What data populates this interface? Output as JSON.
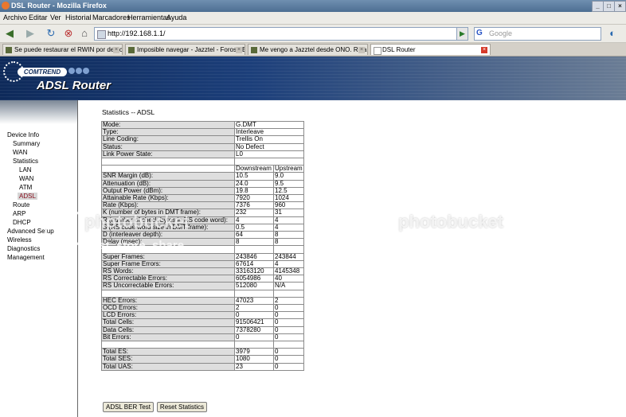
{
  "window": {
    "title": "DSL Router - Mozilla Firefox"
  },
  "menu": [
    "Archivo",
    "Editar",
    "Ver",
    "Historial",
    "Marcadores",
    "Herramientas",
    "Ayuda"
  ],
  "nav": {
    "url": "http://192.168.1.1/",
    "search_placeholder": "Google"
  },
  "tabs": [
    {
      "label": "Se puede restaurar el RWIN por defec..."
    },
    {
      "label": "Imposible navegar - Jazztel - Foros - B..."
    },
    {
      "label": "Me vengo a Jazztel desde ONO. Rela..."
    },
    {
      "label": "DSL Router"
    }
  ],
  "brand": {
    "company": "COMTREND",
    "product": "ADSL Router"
  },
  "sidebar": {
    "items": [
      "Device Info",
      "Summary",
      "WAN",
      "Statistics",
      "LAN",
      "WAN",
      "ATM",
      "ADSL",
      "Route",
      "ARP",
      "DHCP",
      "Advanced Setup",
      "Wireless",
      "Diagnostics",
      "Management"
    ]
  },
  "page": {
    "title": "Statistics -- ADSL"
  },
  "stats": {
    "mode": [
      "Mode:",
      "G.DMT"
    ],
    "type": [
      "Type:",
      "Interleave"
    ],
    "line_coding": [
      "Line Coding:",
      "Trellis On"
    ],
    "status": [
      "Status:",
      "No Defect"
    ],
    "power_state": [
      "Link Power State:",
      "L0"
    ],
    "col_down": "Downstream",
    "col_up": "Upstream",
    "snr": [
      "SNR Margin (dB):",
      "10.5",
      "9.0"
    ],
    "attenuation": [
      "Attenuation (dB):",
      "24.0",
      "9.5"
    ],
    "output_power": [
      "Output Power (dBm):",
      "19.8",
      "12.5"
    ],
    "attainable": [
      "Attainable Rate (Kbps):",
      "7920",
      "1024"
    ],
    "rate": [
      "Rate (Kbps):",
      "7376",
      "960"
    ],
    "k": [
      "K (number of bytes in DMT frame):",
      "232",
      "31"
    ],
    "r": [
      "R (number of check bytes in RS code word):",
      "4",
      "4"
    ],
    "s": [
      "S (RS code word size in DMT frame):",
      "0.5",
      "4"
    ],
    "d": [
      "D (interleaver depth):",
      "64",
      "8"
    ],
    "delay": [
      "Delay (msec):",
      "8",
      "8"
    ],
    "super_frames": [
      "Super Frames:",
      "243846",
      "243844"
    ],
    "super_frame_errors": [
      "Super Frame Errors:",
      "67614",
      "4"
    ],
    "rs_words": [
      "RS Words:",
      "33163120",
      "4145348"
    ],
    "rs_correctable": [
      "RS Correctable Errors:",
      "6054986",
      "40"
    ],
    "rs_uncorrectable": [
      "RS Uncorrectable Errors:",
      "512080",
      "N/A"
    ],
    "hec": [
      "HEC Errors:",
      "47023",
      "2"
    ],
    "ocd": [
      "OCD Errors:",
      "2",
      "0"
    ],
    "lcd": [
      "LCD Errors:",
      "0",
      "0"
    ],
    "total_cells": [
      "Total Cells:",
      "91506421",
      "0"
    ],
    "data_cells": [
      "Data Cells:",
      "7378280",
      "0"
    ],
    "bit_errors": [
      "Bit Errors:",
      "0",
      "0"
    ],
    "total_es": [
      "Total ES:",
      "3979",
      "0"
    ],
    "total_ses": [
      "Total SES:",
      "1080",
      "0"
    ],
    "total_uas": [
      "Total UAS:",
      "23",
      "0"
    ]
  },
  "buttons": {
    "ber_test": "ADSL BER Test",
    "reset": "Reset Statistics"
  },
  "watermark": {
    "brand": "photobucket",
    "tagline": "host. store. share."
  }
}
